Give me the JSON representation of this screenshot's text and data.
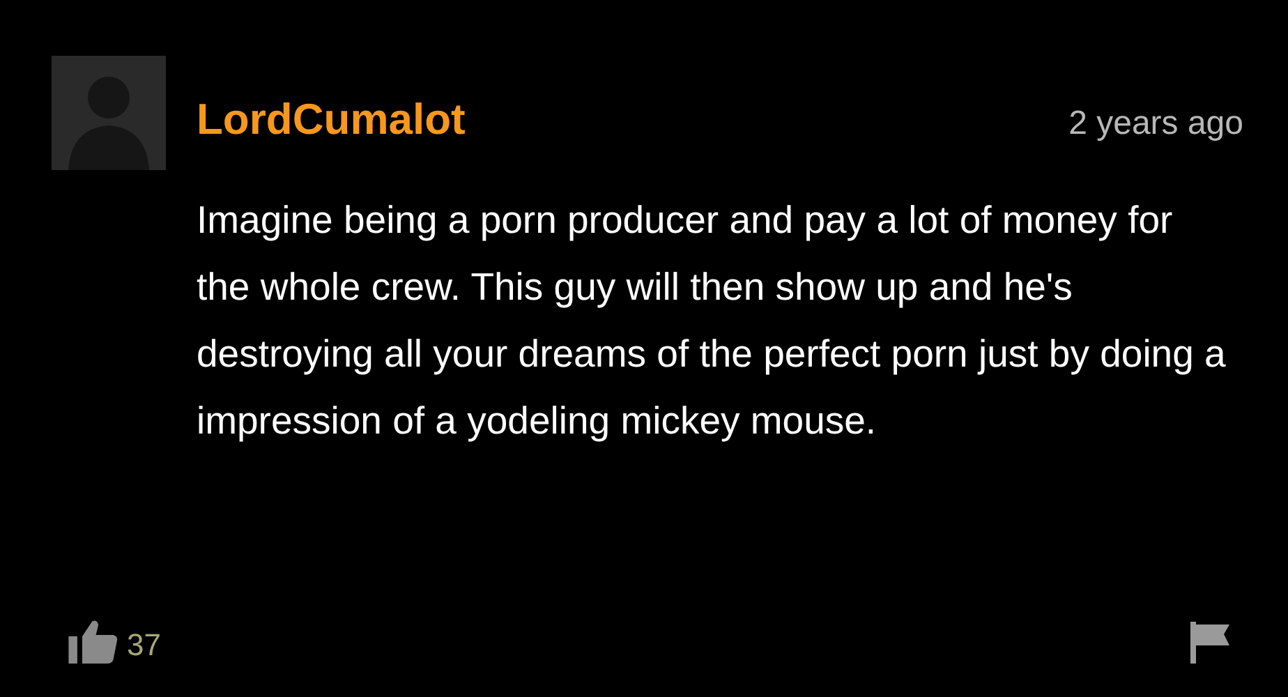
{
  "comment": {
    "author": "LordCumalot",
    "time": "2 years ago",
    "text": "Imagine being a porn producer and pay a lot of money for the whole crew. This guy will then show up and he's destroying all your dreams of the perfect porn just by doing a impression of a yodeling mickey mouse.",
    "likes": "37"
  }
}
